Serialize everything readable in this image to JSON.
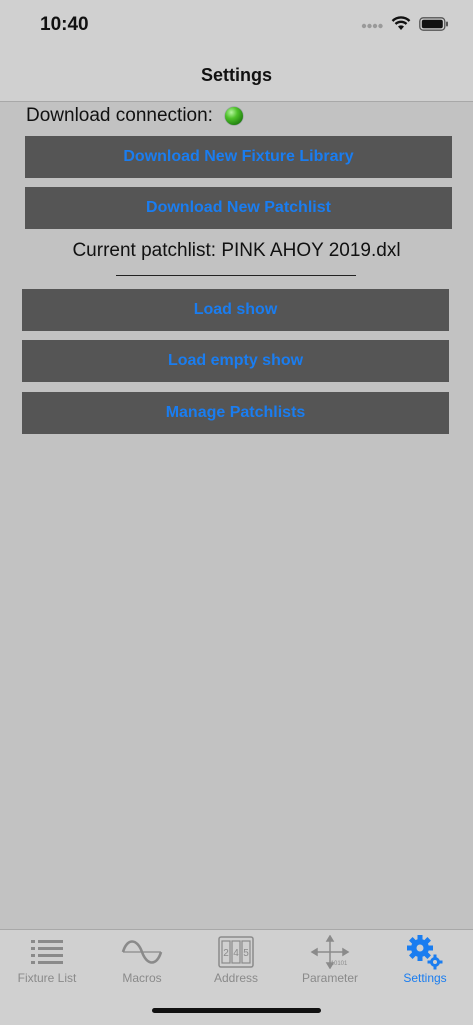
{
  "status_bar": {
    "time": "10:40"
  },
  "nav": {
    "title": "Settings"
  },
  "connection": {
    "label": "Download connection:",
    "status_color": "#3fb51e"
  },
  "buttons": {
    "download_fixture_library": "Download New Fixture Library",
    "download_patchlist": "Download New Patchlist",
    "load_show": "Load show",
    "load_empty_show": "Load empty show",
    "manage_patchlists": "Manage Patchlists"
  },
  "patchlist": {
    "current": "Current patchlist: PINK AHOY 2019.dxl"
  },
  "tabs": [
    {
      "label": "Fixture List",
      "icon": "list-icon",
      "active": false
    },
    {
      "label": "Macros",
      "icon": "sine-wave-icon",
      "active": false
    },
    {
      "label": "Address",
      "icon": "address-counter-icon",
      "digits": "245",
      "active": false
    },
    {
      "label": "Parameter",
      "icon": "parameter-axes-icon",
      "caption": "10101",
      "active": false
    },
    {
      "label": "Settings",
      "icon": "gears-icon",
      "active": true
    }
  ],
  "colors": {
    "accent": "#1a7df0",
    "button_bg": "#555555",
    "background": "#c2c2c2",
    "bars": "#d0d0d0"
  }
}
